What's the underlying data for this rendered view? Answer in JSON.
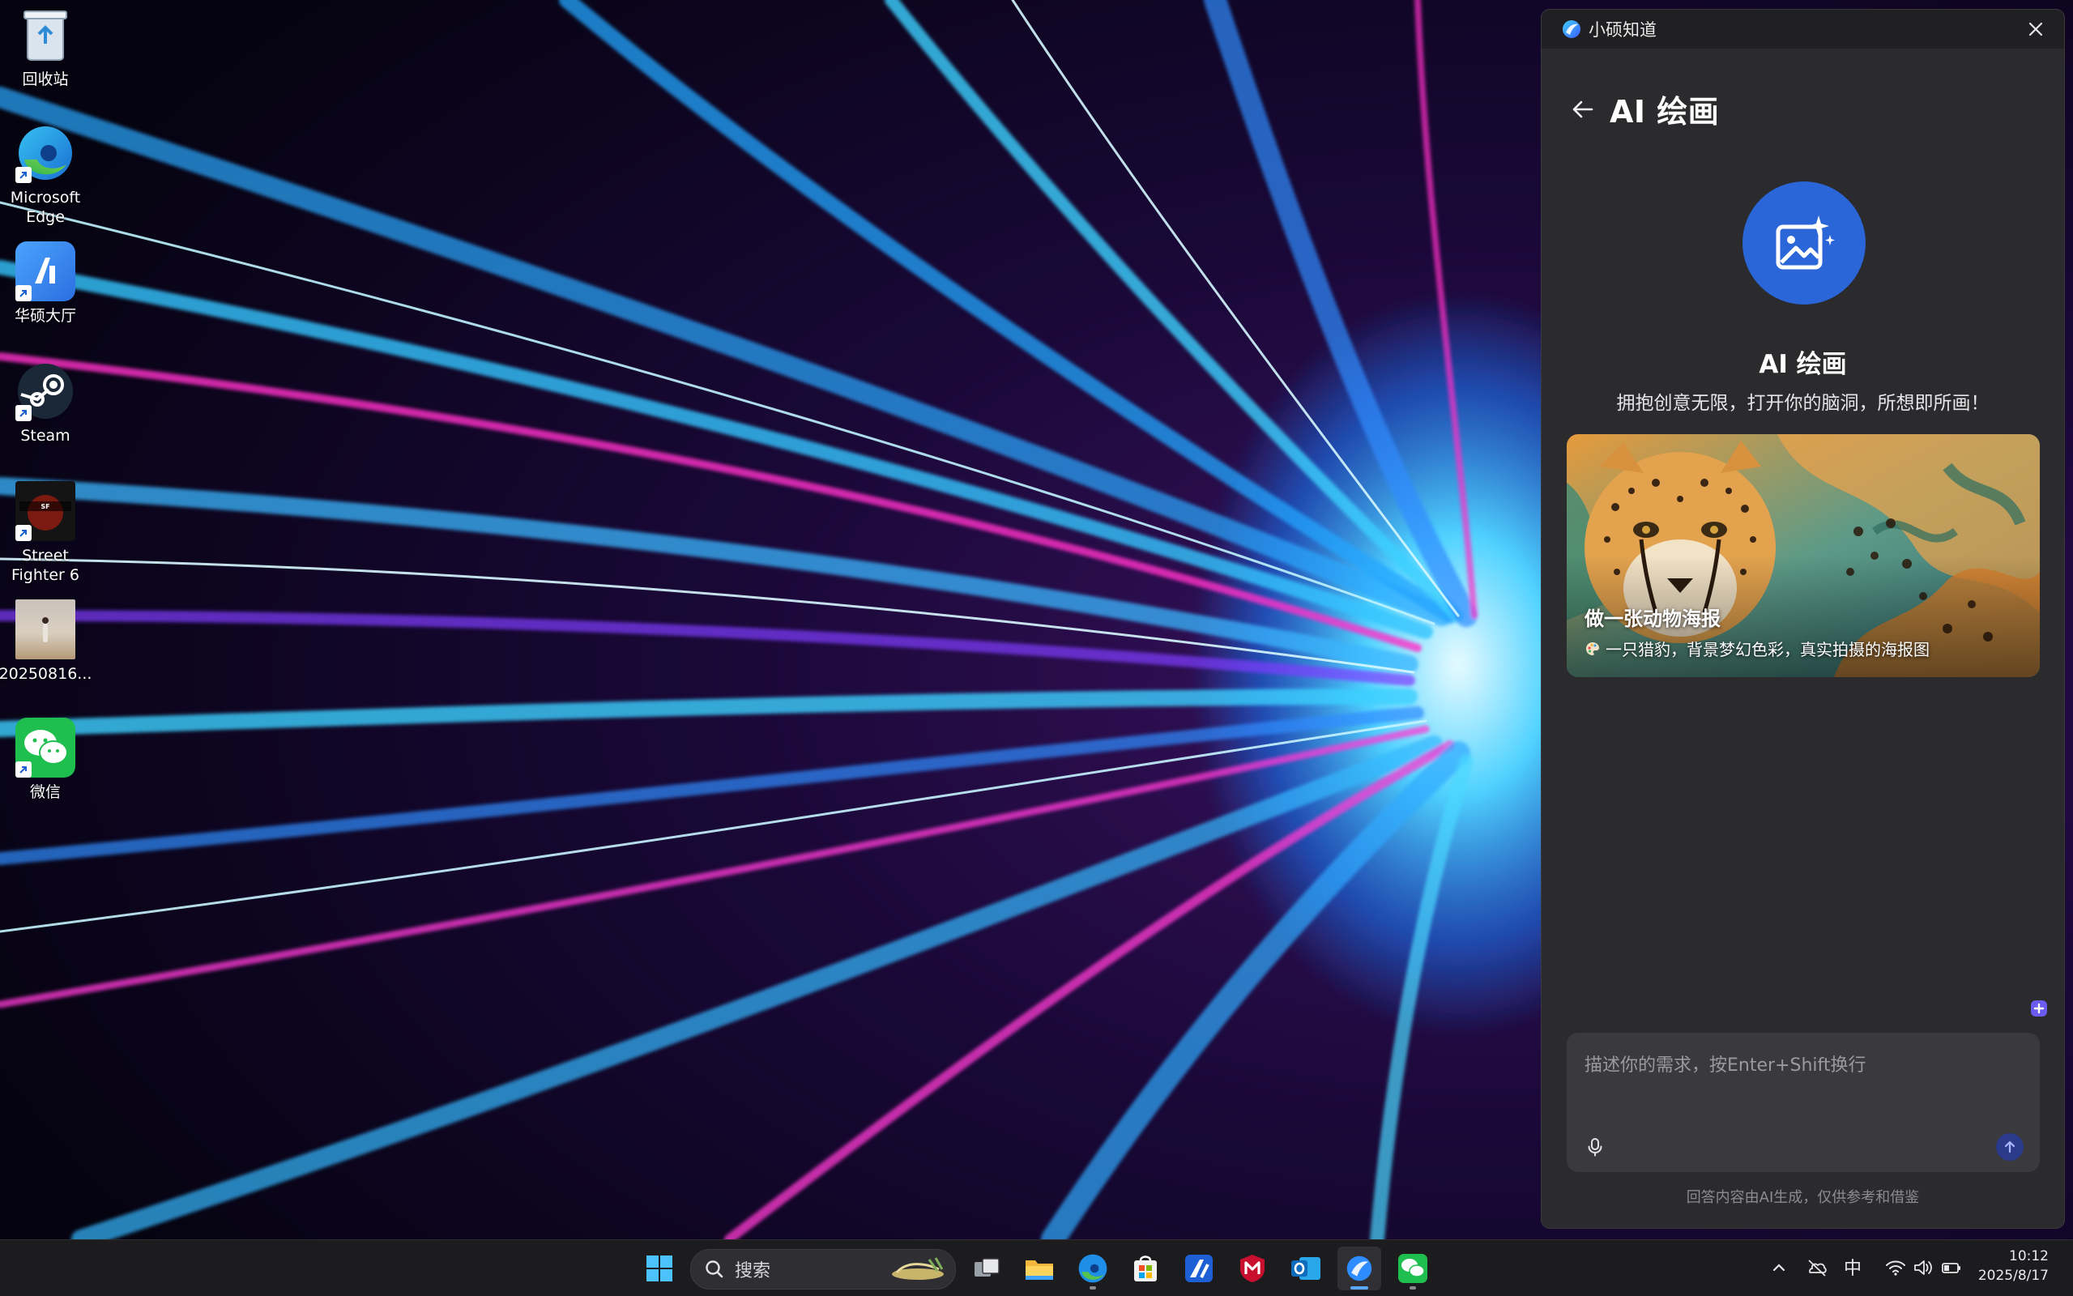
{
  "desktop": {
    "icons": [
      {
        "label": "回收站",
        "icon": "recycle-bin-icon"
      },
      {
        "label": "Microsoft\nEdge",
        "icon": "edge-icon"
      },
      {
        "label": "华硕大厅",
        "icon": "asus-hub-icon"
      },
      {
        "label": "Steam",
        "icon": "steam-icon"
      },
      {
        "label": "Street\nFighter 6",
        "icon": "street-fighter-icon"
      },
      {
        "label": "20250816...",
        "icon": "photo-thumbnail-icon"
      },
      {
        "label": "微信",
        "icon": "wechat-icon"
      }
    ]
  },
  "panel": {
    "app_name": "小硕知道",
    "page_title": "AI 绘画",
    "feature_title": "AI 绘画",
    "feature_subtitle": "拥抱创意无限，打开你的脑洞，所想即所画！",
    "example_card": {
      "title": "做一张动物海报",
      "description": "一只猎豹，背景梦幻色彩，真实拍摄的海报图"
    },
    "input": {
      "placeholder": "描述你的需求，按Enter+Shift换行"
    },
    "disclaimer": "回答内容由AI生成，仅供参考和借鉴"
  },
  "taskbar": {
    "search_label": "搜索",
    "apps": [
      "start-icon",
      "task-view-icon",
      "file-explorer-icon",
      "edge-icon",
      "microsoft-store-icon",
      "myasus-icon",
      "mcafee-icon",
      "outlook-icon",
      "asus-assistant-icon",
      "wechat-icon"
    ],
    "tray": {
      "input_method": "中",
      "time": "10:12",
      "date": "2025/8/17"
    }
  },
  "colors": {
    "panel_bg": "#2b2b2d",
    "accent_blue": "#2b66d9",
    "taskbar_bg": "#1c1c1f"
  }
}
